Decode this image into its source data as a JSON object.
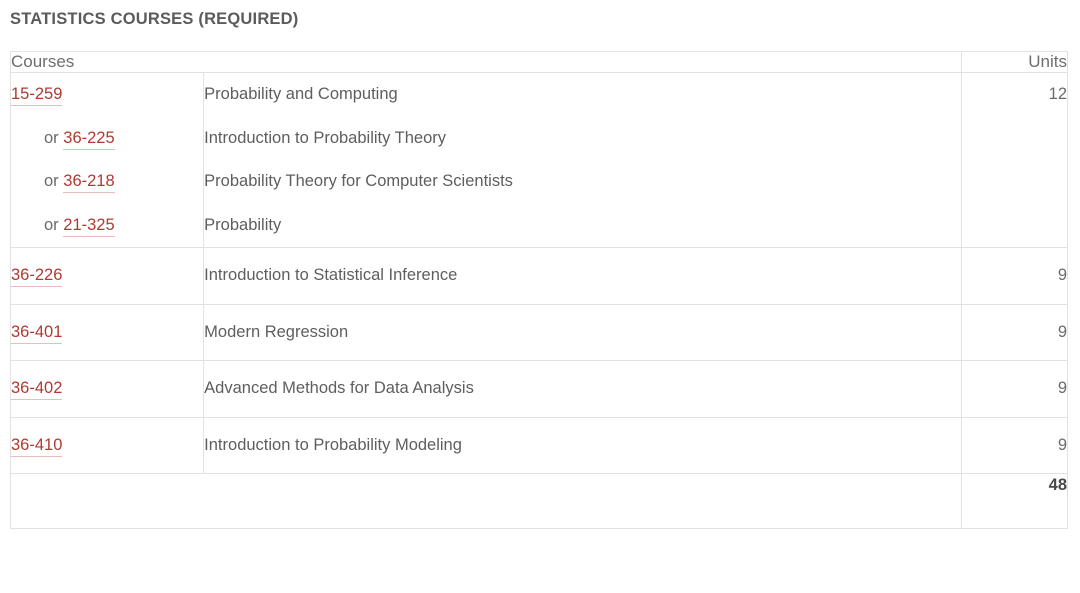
{
  "section": {
    "title": "STATISTICS COURSES (REQUIRED)"
  },
  "table": {
    "headers": {
      "courses": "Courses",
      "units": "Units"
    },
    "rows": [
      {
        "units": "12",
        "lines": [
          {
            "or": "",
            "code": "15-259",
            "title": "Probability and Computing"
          },
          {
            "or": "or",
            "code": "36-225",
            "title": "Introduction to Probability Theory"
          },
          {
            "or": "or",
            "code": "36-218",
            "title": "Probability Theory for Computer Scientists"
          },
          {
            "or": "or",
            "code": "21-325",
            "title": "Probability"
          }
        ]
      },
      {
        "units": "9",
        "lines": [
          {
            "or": "",
            "code": "36-226",
            "title": "Introduction to Statistical Inference"
          }
        ]
      },
      {
        "units": "9",
        "lines": [
          {
            "or": "",
            "code": "36-401",
            "title": "Modern Regression"
          }
        ]
      },
      {
        "units": "9",
        "lines": [
          {
            "or": "",
            "code": "36-402",
            "title": "Advanced Methods for Data Analysis"
          }
        ]
      },
      {
        "units": "9",
        "lines": [
          {
            "or": "",
            "code": "36-410",
            "title": "Introduction to Probability Modeling"
          }
        ]
      }
    ],
    "total": {
      "label": "",
      "units": "48"
    }
  },
  "colors": {
    "link": "#b03a32",
    "link_underline": "#e8bdb9",
    "text": "#5e5e5e",
    "title": "#5b5b5b",
    "border": "#e2e2e2"
  }
}
